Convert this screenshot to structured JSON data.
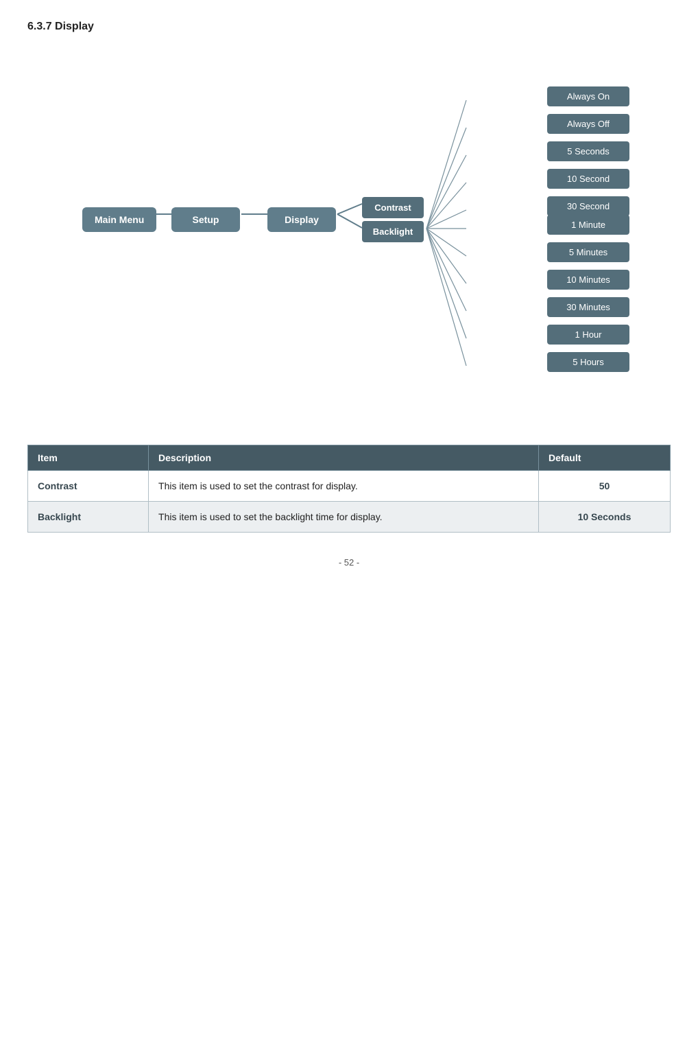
{
  "page": {
    "title": "6.3.7 Display",
    "footer": "- 52 -"
  },
  "diagram": {
    "nav_boxes": [
      {
        "id": "main-menu",
        "label": "Main Menu"
      },
      {
        "id": "setup",
        "label": "Setup"
      },
      {
        "id": "display",
        "label": "Display"
      }
    ],
    "connectors": [
      {
        "id": "contrast",
        "label": "Contrast"
      },
      {
        "id": "backlight",
        "label": "Backlight"
      }
    ],
    "options": [
      {
        "id": "always-on",
        "label": "Always On"
      },
      {
        "id": "always-off",
        "label": "Always Off"
      },
      {
        "id": "5-seconds",
        "label": "5 Seconds"
      },
      {
        "id": "10-second",
        "label": "10 Second"
      },
      {
        "id": "30-second",
        "label": "30 Second"
      },
      {
        "id": "1-minute",
        "label": "1 Minute"
      },
      {
        "id": "5-minutes",
        "label": "5 Minutes"
      },
      {
        "id": "10-minutes",
        "label": "10 Minutes"
      },
      {
        "id": "30-minutes",
        "label": "30 Minutes"
      },
      {
        "id": "1-hour",
        "label": "1 Hour"
      },
      {
        "id": "5-hours",
        "label": "5 Hours"
      }
    ]
  },
  "table": {
    "headers": [
      "Item",
      "Description",
      "Default"
    ],
    "rows": [
      {
        "item": "Contrast",
        "description": "This item is used to set the contrast for display.",
        "default": "50"
      },
      {
        "item": "Backlight",
        "description": "This item is used to set the backlight time for display.",
        "default": "10 Seconds"
      }
    ]
  }
}
